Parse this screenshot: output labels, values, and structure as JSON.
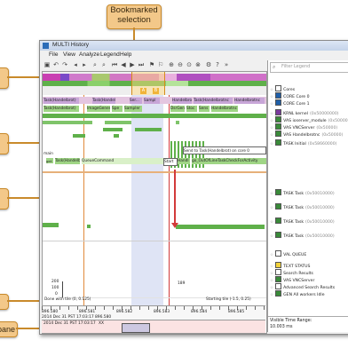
{
  "callouts": {
    "bookmarked": "Bookmarked selection",
    "pane": "pane"
  },
  "window": {
    "title": "MULTI History",
    "menus": [
      "File",
      "View",
      "Analyze",
      "Legend",
      "Help"
    ],
    "legend_filter_placeholder": "Filter Legend"
  },
  "graph": {
    "markers": [
      "A",
      "B"
    ],
    "rows": {
      "task_row_1": [
        "Task(Handelbrot)",
        "Task(Handelbr",
        "Ser...",
        "Sampl",
        "Handelbrot",
        "Task(Handelbrotnc",
        "Handelbrotnc"
      ],
      "task_row_2": [
        "Task(Handelbrot)",
        "ImageGener",
        "Spe",
        "Sampler",
        "DsrGen",
        "Stoc",
        "Sens",
        "Handelbrotnc"
      ],
      "main_label": "main",
      "main_row": [
        "Task(Handelbr",
        "QueueCommand",
        "Start",
        "Handl",
        "go_OutOfLineTaskCheckForActivity"
      ],
      "send_label": "Send to Task(Handelbrot) on core 0",
      "main_small": "get",
      "main_small2": "get"
    },
    "plot": {
      "y_ticks": [
        "200",
        "100",
        "0"
      ],
      "counter": "189",
      "done_label": "Done with tile (0, 0.125)",
      "starting_label": "Starting tile (-1.5, 0.25)",
      "sync_label": "SynchronousSend",
      "event1": "End of Running (User Code) on Core 0 -> Start of",
      "cursor_time": "896.882"
    },
    "time_axis": {
      "start_prefix": "2014 Dec 31 PST 17:03:17",
      "ticks": [
        "896.580",
        "896.581",
        "896.582",
        "896.583",
        "896.584",
        "896.585"
      ],
      "start_time": "896.580",
      "range_start": "2014 Dec 31 PST 17:03:17",
      "xx": "XX"
    }
  },
  "legend": {
    "items": [
      {
        "label": "Cores",
        "id": "",
        "color": "#ffffff"
      },
      {
        "label": "CORE Core 0",
        "id": "",
        "color": "#1f5fa8"
      },
      {
        "label": "CORE Core 1",
        "id": "",
        "color": "#1f5fa8"
      },
      {
        "label": "KRNL kernel",
        "id": "(0x50000000)",
        "color": "#7b3a9e"
      },
      {
        "label": "VAS ioserver_module",
        "id": "(0x50000)",
        "color": "#3a8a3a"
      },
      {
        "label": "VAS VNCServer",
        "id": "(0x50000)",
        "color": "#3a8a3a"
      },
      {
        "label": "VAS Handelbrotnc",
        "id": "(0x50000)",
        "color": "#3a8a3a"
      },
      {
        "label": "TASK Initial",
        "id": "(0x58660000)",
        "color": "#3a8a3a"
      },
      {
        "label": "TASK Task",
        "id": "(0x50010000)",
        "color": "#3a8a3a"
      },
      {
        "label": "TASK Task",
        "id": "(0x50010000)",
        "color": "#3a8a3a"
      },
      {
        "label": "TASK Task",
        "id": "(0x50010000)",
        "color": "#3a8a3a"
      },
      {
        "label": "TASK Task",
        "id": "(0x50010000)",
        "color": "#3a8a3a"
      },
      {
        "label": "VAL QUEUE",
        "id": "",
        "color": "#ffffff"
      },
      {
        "label": "TEXT STATUS",
        "id": "",
        "color": "#f2d23a"
      },
      {
        "label": "Search Results",
        "id": "",
        "color": "#ffffff"
      },
      {
        "label": "VAS VNCServer",
        "id": "",
        "color": "#3a8a3a"
      },
      {
        "label": "Advanced Search Results",
        "id": "",
        "color": "#ffffff"
      },
      {
        "label": "GEN All workers Idle",
        "id": "",
        "color": "#3a8a3a"
      }
    ],
    "visible_range_label": "Visible Time Range:",
    "visible_range_value": "10.003 ms"
  },
  "colors": {
    "accent": "#f3c889",
    "task_green": "#5fb04a",
    "selection": "#cfd8f2",
    "arrow_red": "#d23a3a"
  }
}
